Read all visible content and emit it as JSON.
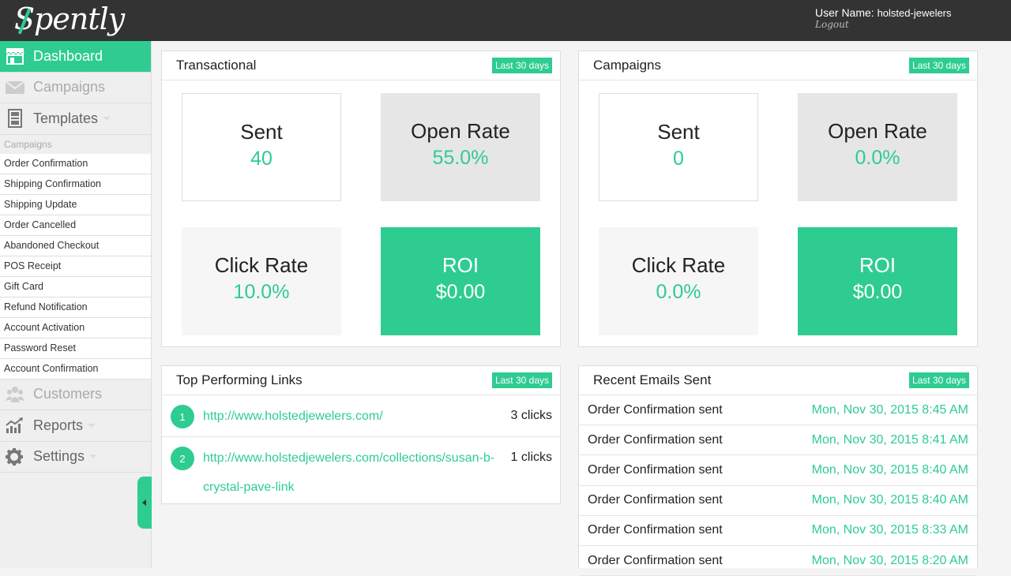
{
  "app": {
    "logo": "Spently"
  },
  "header": {
    "user_label": "User Name:",
    "user_name": "holsted-jewelers",
    "logout": "Logout"
  },
  "sidebar": {
    "main_top": [
      {
        "label": "Dashboard",
        "icon": "store-icon"
      },
      {
        "label": "Campaigns",
        "icon": "envelope-icon"
      },
      {
        "label": "Templates",
        "icon": "template-icon"
      }
    ],
    "sub_head": "Campaigns",
    "sub_items": [
      "Order Confirmation",
      "Shipping Confirmation",
      "Shipping Update",
      "Order Cancelled",
      "Abandoned Checkout",
      "POS Receipt",
      "Gift Card",
      "Refund Notification",
      "Account Activation",
      "Password Reset",
      "Account Confirmation"
    ],
    "main_bottom": [
      {
        "label": "Customers",
        "icon": "customers-icon"
      },
      {
        "label": "Reports",
        "icon": "chart-icon"
      },
      {
        "label": "Settings",
        "icon": "gear-icon"
      }
    ]
  },
  "transactional": {
    "title": "Transactional",
    "badge": "Last 30 days",
    "sent_label": "Sent",
    "sent_value": "40",
    "open_label": "Open Rate",
    "open_value": "55.0%",
    "click_label": "Click Rate",
    "click_value": "10.0%",
    "roi_label": "ROI",
    "roi_value": "$0.00"
  },
  "campaigns": {
    "title": "Campaigns",
    "badge": "Last 30 days",
    "sent_label": "Sent",
    "sent_value": "0",
    "open_label": "Open Rate",
    "open_value": "0.0%",
    "click_label": "Click Rate",
    "click_value": "0.0%",
    "roi_label": "ROI",
    "roi_value": "$0.00"
  },
  "top_links": {
    "title": "Top Performing Links",
    "badge": "Last 30 days",
    "rows": [
      {
        "num": "1",
        "url": "http://www.holstedjewelers.com/",
        "clicks": "3 clicks"
      },
      {
        "num": "2",
        "url": "http://www.holstedjewelers.com/collections/susan-b-crystal-pave-link",
        "clicks": "1 clicks"
      }
    ]
  },
  "recent_emails": {
    "title": "Recent Emails Sent",
    "badge": "Last 30 days",
    "rows": [
      {
        "text": "Order Confirmation sent",
        "date": "Mon, Nov 30, 2015 8:45 AM"
      },
      {
        "text": "Order Confirmation sent",
        "date": "Mon, Nov 30, 2015 8:41 AM"
      },
      {
        "text": "Order Confirmation sent",
        "date": "Mon, Nov 30, 2015 8:40 AM"
      },
      {
        "text": "Order Confirmation sent",
        "date": "Mon, Nov 30, 2015 8:40 AM"
      },
      {
        "text": "Order Confirmation sent",
        "date": "Mon, Nov 30, 2015 8:33 AM"
      },
      {
        "text": "Order Confirmation sent",
        "date": "Mon, Nov 30, 2015 8:20 AM"
      }
    ]
  },
  "colors": {
    "accent": "#2ecc91",
    "topbar": "#333333"
  }
}
